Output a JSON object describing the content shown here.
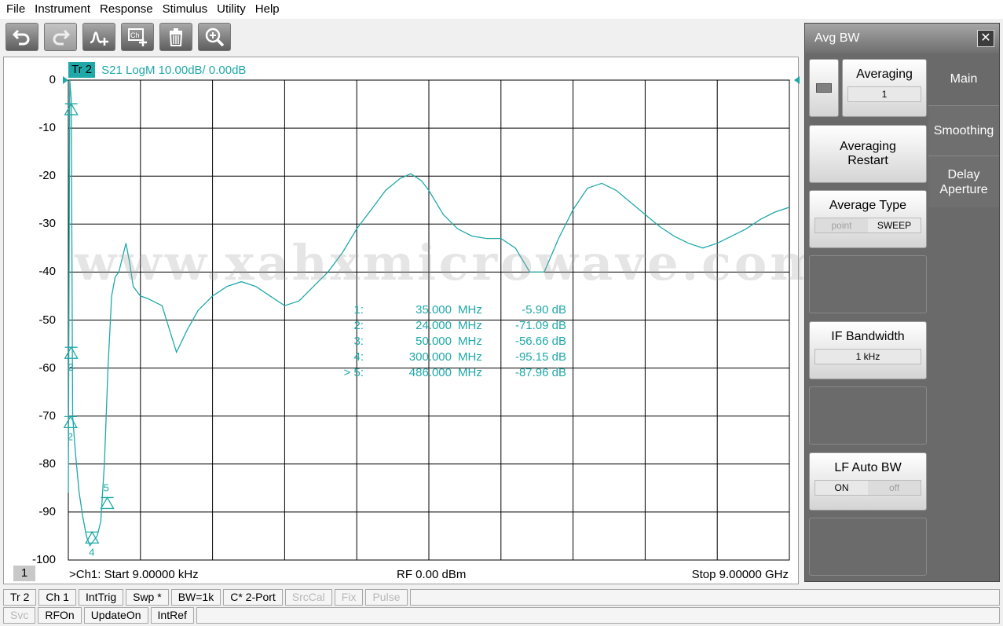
{
  "menu": [
    "File",
    "Instrument",
    "Response",
    "Stimulus",
    "Utility",
    "Help"
  ],
  "toolbar": {
    "buttons": [
      {
        "name": "undo-button",
        "icon": "undo-icon"
      },
      {
        "name": "redo-button",
        "icon": "redo-icon"
      },
      {
        "name": "add-trace-button",
        "icon": "trace-plus-icon"
      },
      {
        "name": "add-channel-button",
        "icon": "channel-plus-icon"
      },
      {
        "name": "delete-button",
        "icon": "trash-icon"
      },
      {
        "name": "zoom-button",
        "icon": "zoom-icon"
      }
    ]
  },
  "trace": {
    "tag": "Tr 2",
    "desc": "S21 LogM 10.00dB/  0.00dB",
    "color": "#20a8a8"
  },
  "y_ticks": [
    "0",
    "-10",
    "-20",
    "-30",
    "-40",
    "-50",
    "-60",
    "-70",
    "-80",
    "-90",
    "-100"
  ],
  "watermark": "www.xahxmicrowave.com",
  "markers": [
    {
      "idx": "1:",
      "freq": "35.000",
      "unit": "MHz",
      "value": "-5.90 dB"
    },
    {
      "idx": "2:",
      "freq": "24.000",
      "unit": "MHz",
      "value": "-71.09 dB"
    },
    {
      "idx": "3:",
      "freq": "50.000",
      "unit": "MHz",
      "value": "-56.66 dB"
    },
    {
      "idx": "4:",
      "freq": "300.000",
      "unit": "MHz",
      "value": "-95.15 dB"
    },
    {
      "idx": "> 5:",
      "freq": "486.000",
      "unit": "MHz",
      "value": "-87.96 dB"
    }
  ],
  "marker_labels": [
    "2",
    "3",
    "4",
    "5"
  ],
  "footer": {
    "channel": "1",
    "start": ">Ch1:  Start  9.00000 kHz",
    "power": "RF    0.00 dBm",
    "stop": "Stop  9.00000 GHz"
  },
  "panel": {
    "title": "Avg BW",
    "close": "✕",
    "tabs": [
      "Main",
      "Smoothing",
      "Delay\nAperture"
    ],
    "averaging_label": "Averaging",
    "averaging_value": "1",
    "restart_label": "Averaging Restart",
    "avg_type_label": "Average Type",
    "avg_type_options": [
      "point",
      "SWEEP"
    ],
    "if_bw_label": "IF Bandwidth",
    "if_bw_value": "1 kHz",
    "lf_auto_label": "LF Auto BW",
    "lf_auto_options": [
      "ON",
      "off"
    ]
  },
  "status_row1": [
    "Tr 2",
    "Ch 1",
    "IntTrig",
    "Swp *",
    "BW=1k",
    "C* 2-Port",
    "SrcCal",
    "Fix",
    "Pulse"
  ],
  "status_row1_dim": [
    false,
    false,
    false,
    false,
    false,
    false,
    true,
    true,
    true
  ],
  "status_row2": [
    "Svc",
    "RFOn",
    "UpdateOn",
    "IntRef"
  ],
  "status_row2_dim": [
    true,
    false,
    false,
    false
  ],
  "chart_data": {
    "type": "line",
    "xlabel": "",
    "ylabel": "",
    "x_range": [
      "9.00000 kHz",
      "9.00000 GHz"
    ],
    "ylim": [
      -100,
      0
    ],
    "grid": true,
    "series": [
      {
        "x_fraction": [
          0.0,
          0.002,
          0.004,
          0.006,
          0.01,
          0.015,
          0.02,
          0.025,
          0.03,
          0.035,
          0.04,
          0.045,
          0.05,
          0.055,
          0.06,
          0.065,
          0.07,
          0.075,
          0.08,
          0.085,
          0.09,
          0.1,
          0.11,
          0.13,
          0.15,
          0.165,
          0.18,
          0.2,
          0.22,
          0.24,
          0.26,
          0.28,
          0.3,
          0.32,
          0.34,
          0.36,
          0.38,
          0.4,
          0.42,
          0.44,
          0.46,
          0.475,
          0.49,
          0.5,
          0.51,
          0.52,
          0.54,
          0.56,
          0.58,
          0.6,
          0.62,
          0.64,
          0.66,
          0.68,
          0.7,
          0.72,
          0.74,
          0.76,
          0.78,
          0.8,
          0.82,
          0.84,
          0.86,
          0.88,
          0.9,
          0.92,
          0.94,
          0.96,
          0.98,
          1.0
        ],
        "y": [
          -86,
          0,
          -4,
          -70,
          -78,
          -86,
          -91,
          -95,
          -97,
          -96,
          -95,
          -92,
          -80,
          -60,
          -45,
          -41,
          -40,
          -37,
          -34,
          -38,
          -43,
          -45,
          -45.5,
          -47,
          -56.7,
          -52,
          -48,
          -45,
          -43,
          -42,
          -43,
          -45,
          -47,
          -46,
          -43,
          -40,
          -36,
          -31,
          -27,
          -23,
          -20.5,
          -19.5,
          -21,
          -23,
          -25.5,
          -28,
          -31,
          -32.5,
          -33,
          -33,
          -35,
          -40,
          -40,
          -33,
          -27,
          -22.5,
          -21.5,
          -23,
          -25.5,
          -28,
          -30.5,
          -32.5,
          -34,
          -35,
          -34,
          -32.5,
          -31,
          -29,
          -27.5,
          -26.5
        ]
      }
    ]
  }
}
